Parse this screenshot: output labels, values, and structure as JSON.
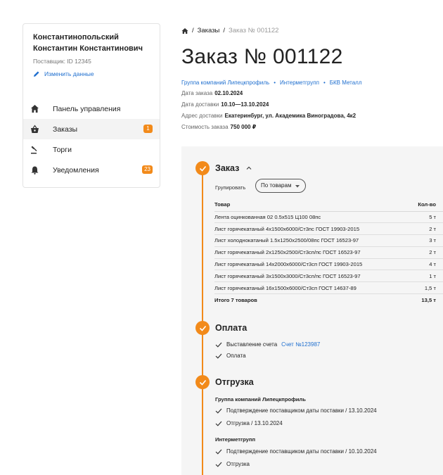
{
  "user": {
    "name": "Константинопольский Константин Константинович",
    "supplier_id": "Поставщик: ID 12345",
    "edit_label": "Изменить данные"
  },
  "nav": [
    {
      "label": "Панель управления",
      "icon": "home-icon",
      "badge": ""
    },
    {
      "label": "Заказы",
      "icon": "basket-icon",
      "badge": "1"
    },
    {
      "label": "Торги",
      "icon": "gavel-icon",
      "badge": ""
    },
    {
      "label": "Уведомления",
      "icon": "bell-icon",
      "badge": "23"
    }
  ],
  "breadcrumb": {
    "sep": "/",
    "orders": "Заказы",
    "current": "Заказ № 001122"
  },
  "order": {
    "title": "Заказ № 001122",
    "suppliers": [
      "Группа компаний Липецкпрофиль",
      "Интерметгрупп",
      "БКВ Металл"
    ],
    "date_label": "Дата заказа",
    "date_value": "02.10.2024",
    "delivery_label": "Дата доставки",
    "delivery_value": "10.10—13.10.2024",
    "address_label": "Адрес доставки",
    "address_value": "Екатеринбург, ул. Академика Виноградова, 4к2",
    "cost_label": "Стоимость заказа",
    "cost_value": "750 000 ₽"
  },
  "order_section": {
    "title": "Заказ",
    "group_label": "Групировать",
    "group_value": "По товарам",
    "col_product": "Товар",
    "col_qty": "Кол-во",
    "items": [
      {
        "name": "Лента оцинкованная 02 0.5х515 Ц100 08пс",
        "qty": "5 т"
      },
      {
        "name": "Лист горячекатаный 4х1500х6000/Ст3пс ГОСТ 19903-2015",
        "qty": "2 т"
      },
      {
        "name": "Лист холоднокатаный 1.5х1250х2500/08пс ГОСТ 16523-97",
        "qty": "3 т"
      },
      {
        "name": "Лист горячекатаный 2х1250х2500/Ст3сп/пс ГОСТ 16523-97",
        "qty": "2 т"
      },
      {
        "name": "Лист горячекатаный 14х2000х6000/Ст3сп ГОСТ 19903-2015",
        "qty": "4 т"
      },
      {
        "name": "Лист горячекатаный 3х1500х3000/Ст3сп/пс ГОСТ 16523-97",
        "qty": "1 т"
      },
      {
        "name": "Лист горячекатаный 16х1500х6000/Ст3сп ГОСТ 14637-89",
        "qty": "1,5 т"
      }
    ],
    "total_label": "Итого 7 товаров",
    "total_qty": "13,5 т"
  },
  "payment_section": {
    "title": "Оплата",
    "invoice_label": "Выставление счета",
    "invoice_link": "Счет №123987",
    "paid_label": "Оплата"
  },
  "shipping_section": {
    "title": "Отгрузка",
    "groups": [
      {
        "name": "Группа компаний Липецкпрофиль",
        "confirm": "Подтверждение поставщиком даты поставки  /  13.10.2024",
        "ship": "Отгрузка  /  13.10.2024"
      },
      {
        "name": "Интерметгрупп",
        "confirm": "Подтверждение поставщиком даты поставки  /  10.10.2024",
        "ship": "Отгрузка"
      }
    ]
  },
  "colors": {
    "accent": "#f28a1a",
    "link": "#1f6fcf"
  }
}
